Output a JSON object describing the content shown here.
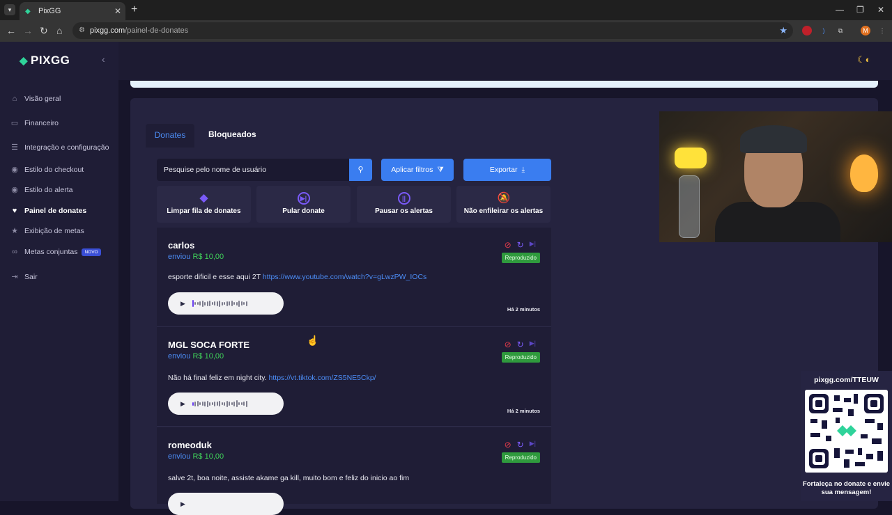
{
  "browser": {
    "tab_title": "PixGG",
    "tab_favicon": "pixgg-logo-icon",
    "url_domain": "pixgg.com",
    "url_path": "/painel-de-donates"
  },
  "sidebar": {
    "logo_text": "PIXGG",
    "items": [
      {
        "label": "Visão geral",
        "icon": "home-icon"
      },
      {
        "label": "Financeiro",
        "icon": "wallet-icon"
      },
      {
        "label": "Integração e configuração",
        "icon": "settings-icon"
      },
      {
        "label": "Estilo do checkout",
        "icon": "palette-icon"
      },
      {
        "label": "Estilo do alerta",
        "icon": "palette-icon"
      },
      {
        "label": "Painel de donates",
        "icon": "donate-icon",
        "active": true
      },
      {
        "label": "Exibição de metas",
        "icon": "star-icon"
      },
      {
        "label": "Metas conjuntas",
        "icon": "link-icon",
        "badge": "NOVO"
      },
      {
        "label": "Sair",
        "icon": "logout-icon"
      }
    ]
  },
  "tabs": {
    "donates": "Donates",
    "bloqueados": "Bloqueados"
  },
  "toolbar": {
    "search_placeholder": "Pesquise pelo nome de usuário",
    "filters_label": "Aplicar filtros",
    "export_label": "Exportar"
  },
  "actions": [
    {
      "label": "Limpar fila de donates",
      "icon": "eraser-icon"
    },
    {
      "label": "Pular donate",
      "icon": "skip-icon"
    },
    {
      "label": "Pausar os alertas",
      "icon": "pause-icon"
    },
    {
      "label": "Não enfileirar os alertas",
      "icon": "bell-off-icon"
    }
  ],
  "donates": [
    {
      "name": "carlos",
      "sent_label": "enviou",
      "amount": "R$ 10,00",
      "message": "esporte dificil e esse aqui 2T",
      "link": "https://www.youtube.com/watch?v=gLwzPW_IOCs",
      "status": "Reproduzido",
      "time": "Há 2 minutos"
    },
    {
      "name": "MGL SOCA FORTE",
      "sent_label": "enviou",
      "amount": "R$ 10,00",
      "message": "Não há final feliz em night city.",
      "link": "https://vt.tiktok.com/ZS5NE5Ckp/",
      "status": "Reproduzido",
      "time": "Há 2 minutos"
    },
    {
      "name": "romeoduk",
      "sent_label": "enviou",
      "amount": "R$ 10,00",
      "message": "salve 2t, boa noite, assiste akame ga kill, muito bom e feliz do inicio ao fim",
      "link": "",
      "status": "Reproduzido",
      "time": ""
    }
  ],
  "overlay": {
    "qr_url": "pixgg.com/TTEUW",
    "qr_caption": "Fortaleça no donate e envie sua mensagem!"
  },
  "colors": {
    "accent_blue": "#3a7df0",
    "accent_green": "#2fd39a",
    "status_green": "#2f9a3d",
    "ban_red": "#e23a4a",
    "purple": "#7a5af8"
  }
}
